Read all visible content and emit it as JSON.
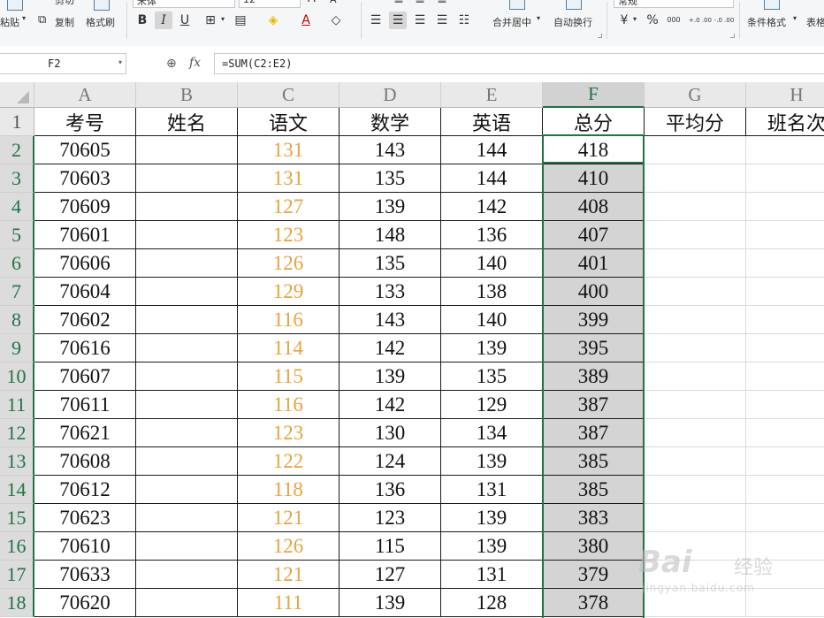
{
  "ribbon": {
    "paste_label": "粘贴",
    "copy_label": "复制",
    "format_painter_label": "格式刷",
    "cut_label": "剪切",
    "font_name": "宋体",
    "font_size": "12",
    "merge_center_label": "合并居中",
    "wrap_text_label": "自动换行",
    "number_format": "常规",
    "conditional_format_label": "条件格式",
    "table_style_label": "表格",
    "percent_label": "%",
    "thousands_label": "000",
    "inc_decimal_label": "+.0 .00",
    "dec_decimal_label": "-.0 .00"
  },
  "formula_bar": {
    "cell_ref": "F2",
    "fx_label": "fx",
    "formula": "=SUM(C2:E2)"
  },
  "grid": {
    "columns": [
      "A",
      "B",
      "C",
      "D",
      "E",
      "F",
      "G",
      "H"
    ],
    "selected_column": "F",
    "rows": [
      {
        "n": "1",
        "cells": [
          "考号",
          "姓名",
          "语文",
          "数学",
          "英语",
          "总分",
          "平均分",
          "班名次"
        ]
      },
      {
        "n": "2",
        "cells": [
          "70605",
          "",
          "131",
          "143",
          "144",
          "418",
          "",
          ""
        ]
      },
      {
        "n": "3",
        "cells": [
          "70603",
          "",
          "131",
          "135",
          "144",
          "410",
          "",
          ""
        ]
      },
      {
        "n": "4",
        "cells": [
          "70609",
          "",
          "127",
          "139",
          "142",
          "408",
          "",
          ""
        ]
      },
      {
        "n": "5",
        "cells": [
          "70601",
          "",
          "123",
          "148",
          "136",
          "407",
          "",
          ""
        ]
      },
      {
        "n": "6",
        "cells": [
          "70606",
          "",
          "126",
          "135",
          "140",
          "401",
          "",
          ""
        ]
      },
      {
        "n": "7",
        "cells": [
          "70604",
          "",
          "129",
          "133",
          "138",
          "400",
          "",
          ""
        ]
      },
      {
        "n": "8",
        "cells": [
          "70602",
          "",
          "116",
          "143",
          "140",
          "399",
          "",
          ""
        ]
      },
      {
        "n": "9",
        "cells": [
          "70616",
          "",
          "114",
          "142",
          "139",
          "395",
          "",
          ""
        ]
      },
      {
        "n": "10",
        "cells": [
          "70607",
          "",
          "115",
          "139",
          "135",
          "389",
          "",
          ""
        ]
      },
      {
        "n": "11",
        "cells": [
          "70611",
          "",
          "116",
          "142",
          "129",
          "387",
          "",
          ""
        ]
      },
      {
        "n": "12",
        "cells": [
          "70621",
          "",
          "123",
          "130",
          "134",
          "387",
          "",
          ""
        ]
      },
      {
        "n": "13",
        "cells": [
          "70608",
          "",
          "122",
          "124",
          "139",
          "385",
          "",
          ""
        ]
      },
      {
        "n": "14",
        "cells": [
          "70612",
          "",
          "118",
          "136",
          "131",
          "385",
          "",
          ""
        ]
      },
      {
        "n": "15",
        "cells": [
          "70623",
          "",
          "121",
          "123",
          "139",
          "383",
          "",
          ""
        ]
      },
      {
        "n": "16",
        "cells": [
          "70610",
          "",
          "126",
          "115",
          "139",
          "380",
          "",
          ""
        ]
      },
      {
        "n": "17",
        "cells": [
          "70633",
          "",
          "121",
          "127",
          "131",
          "379",
          "",
          ""
        ]
      },
      {
        "n": "18",
        "cells": [
          "70620",
          "",
          "111",
          "139",
          "128",
          "378",
          "",
          ""
        ]
      }
    ]
  },
  "watermark": {
    "brand": "Bai",
    "brand_cn": "经验",
    "url": "jingyan.baidu.com"
  },
  "colors": {
    "accent_green": "#217346",
    "chinese_score_orange": "#e8a33c",
    "selection_gray": "#d4d4d4"
  }
}
